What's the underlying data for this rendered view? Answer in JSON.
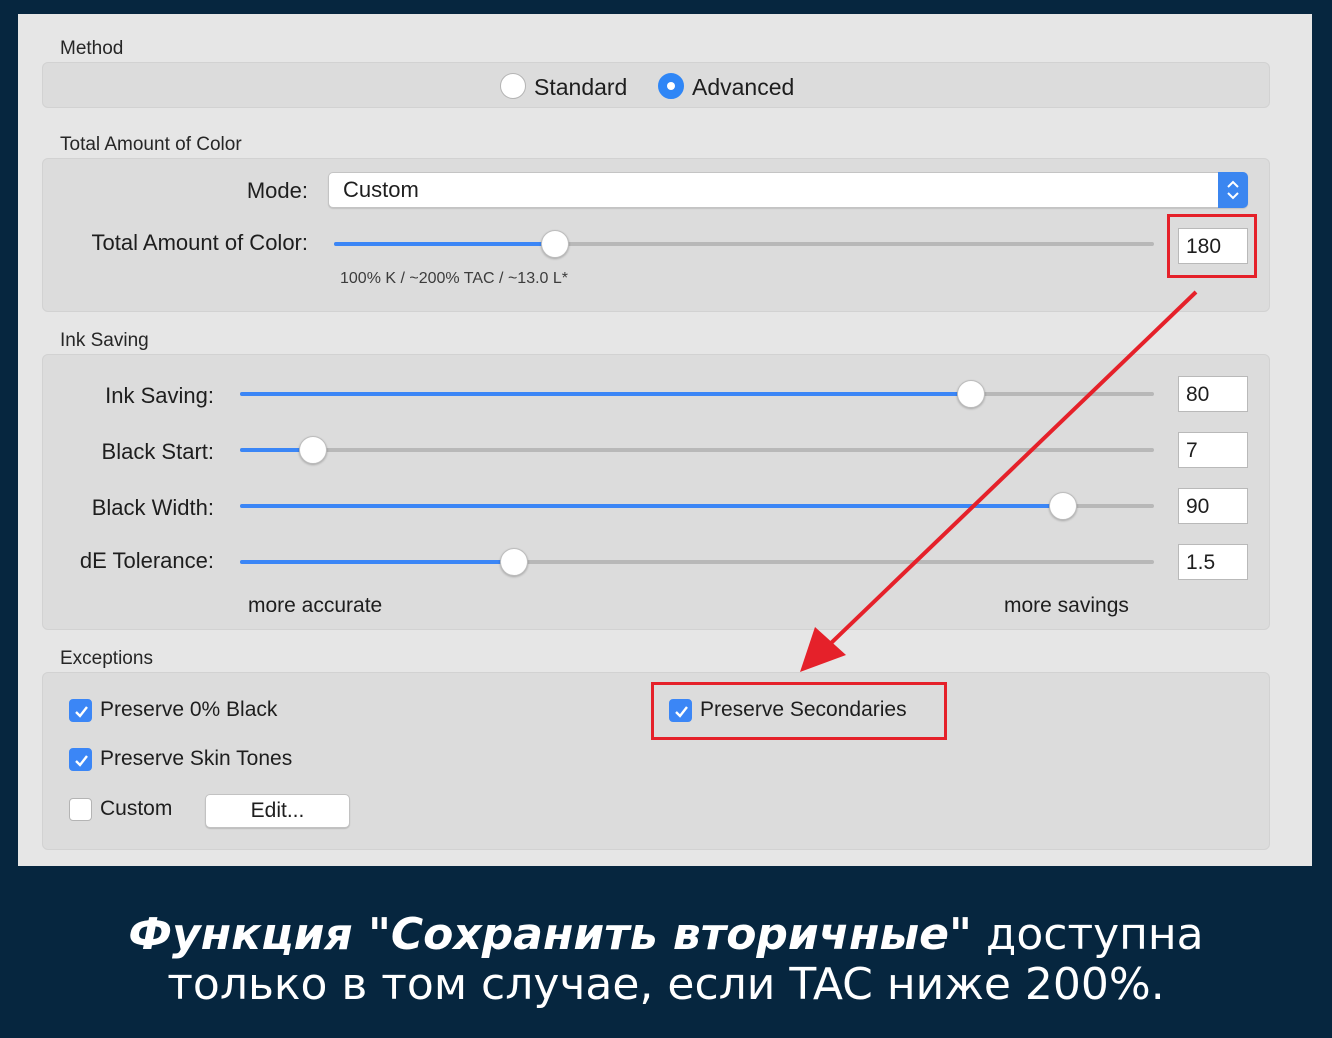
{
  "method": {
    "title": "Method",
    "options": [
      {
        "label": "Standard",
        "selected": false
      },
      {
        "label": "Advanced",
        "selected": true
      }
    ]
  },
  "tac": {
    "title": "Total Amount of Color",
    "mode_label": "Mode:",
    "mode_value": "Custom",
    "slider_label": "Total Amount of Color:",
    "slider_fraction": 0.27,
    "value": "180",
    "note": "100% K / ~200% TAC / ~13.0 L*"
  },
  "ink": {
    "title": "Ink Saving",
    "rows": [
      {
        "label": "Ink Saving:",
        "value": "80",
        "fraction": 0.8
      },
      {
        "label": "Black Start:",
        "value": "7",
        "fraction": 0.08
      },
      {
        "label": "Black Width:",
        "value": "90",
        "fraction": 0.9
      },
      {
        "label": "dE Tolerance:",
        "value": "1.5",
        "fraction": 0.3
      }
    ],
    "left_end": "more accurate",
    "right_end": "more savings"
  },
  "exceptions": {
    "title": "Exceptions",
    "preserve_black": {
      "label": "Preserve 0% Black",
      "checked": true
    },
    "preserve_skin": {
      "label": "Preserve Skin Tones",
      "checked": true
    },
    "custom": {
      "label": "Custom",
      "checked": false
    },
    "edit_button": "Edit...",
    "preserve_secondaries": {
      "label": "Preserve Secondaries",
      "checked": true
    }
  },
  "caption": {
    "emphasis": "Функция \"Сохранить вторичные\"",
    "line1_rest": " доступна",
    "line2": "только в том случае, если TAC ниже 200%."
  },
  "colors": {
    "accent": "#3b86f6",
    "highlight": "#e5212a",
    "background": "#06263f"
  }
}
